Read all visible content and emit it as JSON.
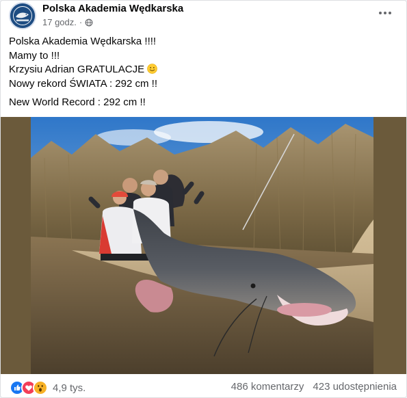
{
  "page": {
    "name": "Polska Akademia Wędkarska",
    "time": "17 godz.",
    "audience_icon": "globe-icon"
  },
  "post": {
    "lines": [
      "Polska Akademia Wędkarska !!!!",
      "Mamy to !!!",
      "Krzysiu Adrian GRATULACJE",
      "Nowy rekord ŚWIATA : 292 cm !!"
    ],
    "line_emoji": "slightly-smiling-face-icon",
    "english_line": "New World Record : 292 cm !!"
  },
  "media": {
    "description_icon": "catfish-photo"
  },
  "footer": {
    "reaction_icons": [
      "like-icon",
      "love-icon",
      "wow-icon"
    ],
    "reactions_count": "4,9 tys.",
    "comments": "486 komentarzy",
    "shares": "423 udostępnienia"
  },
  "colors": {
    "like": "#1877f2",
    "love": "#f33e58",
    "wow": "#f7b125",
    "secondary_text": "#65676b"
  }
}
